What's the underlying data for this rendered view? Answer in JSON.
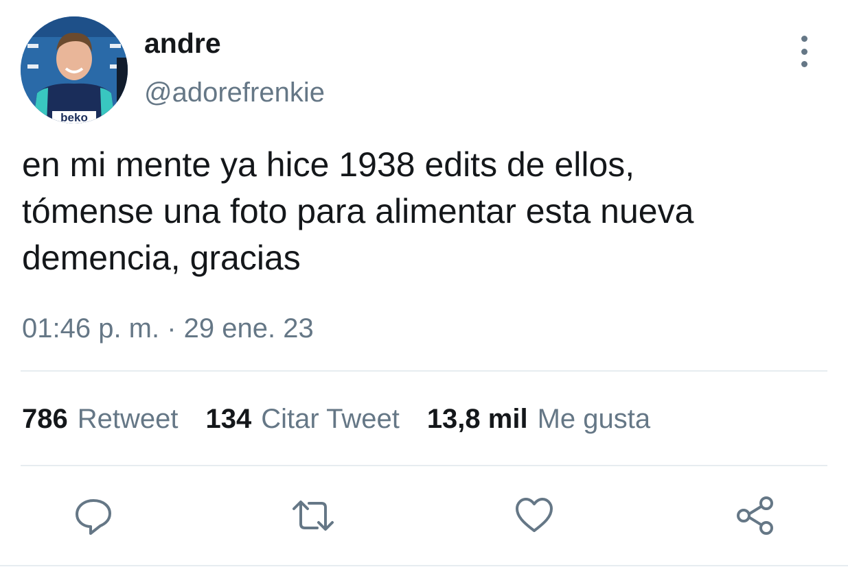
{
  "tweet": {
    "display_name": "andre",
    "handle": "@adorefrenkie",
    "text": "en mi mente ya hice 1938 edits de ellos,\ntómense una foto para alimentar esta nueva\ndemencia, gracias",
    "timestamp": "01:46 p. m. · 29 ene. 23",
    "avatar_text": "beko"
  },
  "stats": {
    "retweets": {
      "count": "786",
      "label": "Retweet"
    },
    "quotes": {
      "count": "134",
      "label": "Citar Tweet"
    },
    "likes": {
      "count": "13,8 mil",
      "label": "Me gusta"
    }
  },
  "actions": [
    {
      "name": "reply",
      "icon": "speech-bubble-icon"
    },
    {
      "name": "retweet",
      "icon": "retweet-arrows-icon"
    },
    {
      "name": "like",
      "icon": "heart-icon"
    },
    {
      "name": "share",
      "icon": "share-nodes-icon"
    }
  ],
  "colors": {
    "primary_text": "#14171a",
    "secondary_text": "#657786",
    "divider": "#e6ecf0",
    "icon": "#657786"
  }
}
